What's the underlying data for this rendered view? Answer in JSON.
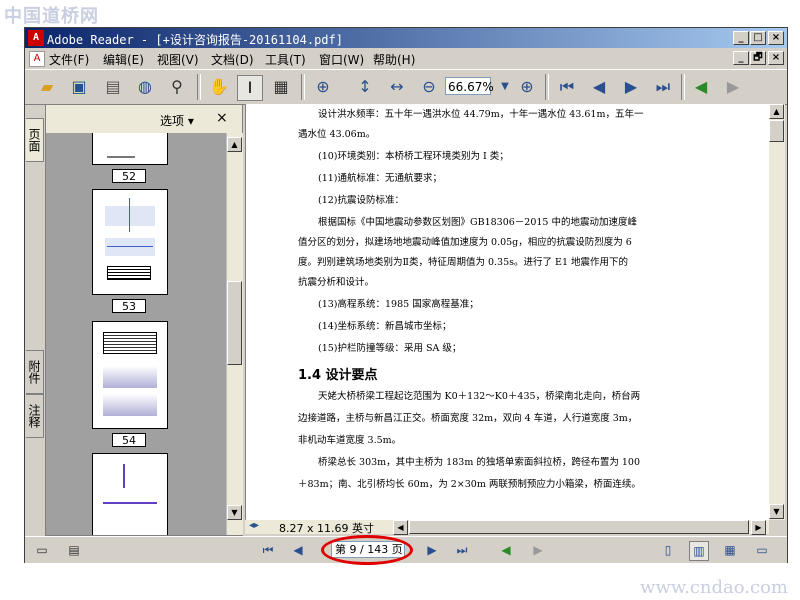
{
  "watermarks": {
    "top": "中国道桥网",
    "bottom": "www.cndao.com"
  },
  "window": {
    "title": "Adobe Reader - [+设计咨询报告-20161104.pdf]",
    "controls": [
      "_",
      "□",
      "×"
    ],
    "doc_controls": [
      "_",
      "🗗",
      "×"
    ]
  },
  "menu": [
    "文件(F)",
    "编辑(E)",
    "视图(V)",
    "文档(D)",
    "工具(T)",
    "窗口(W)",
    "帮助(H)"
  ],
  "toolbar": {
    "zoom_value": "66.67%"
  },
  "side_tabs": [
    "页面",
    "附件",
    "注释"
  ],
  "panel": {
    "options_label": "选项 ▾",
    "close_label": "×",
    "page_numbers": [
      "52",
      "53",
      "54"
    ]
  },
  "document": {
    "lines": [
      "设计洪水频率：五十年一遇洪水位 44.79m，十年一遇水位 43.61m，五年一",
      "遇水位 43.06m。",
      "(10)环境类别：本桥桥工程环境类别为 I 类；",
      "(11)通航标准：无通航要求；",
      "(12)抗震设防标准：",
      "根据国标《中国地震动参数区划图》GB18306－2015 中的地震动加速度峰",
      "值分区的划分，拟建场地地震动峰值加速度为 0.05g，相应的抗震设防烈度为 6",
      "度。判别建筑场地类别为Ⅱ类，特征周期值为 0.35s。进行了 E1 地震作用下的",
      "抗震分析和设计。",
      "(13)高程系统：1985 国家高程基准；",
      "(14)坐标系统：新昌城市坐标；",
      "(15)护栏防撞等级：采用 SA 级；",
      "1.4 设计要点",
      "天姥大桥桥梁工程起讫范围为 K0＋132～K0＋435，桥梁南北走向，桥台两",
      "边接道路，主桥与新昌江正交。桥面宽度 32m，双向 4 车道，人行道宽度 3m，",
      "非机动车道宽度 3.5m。",
      "桥梁总长 303m，其中主桥为 183m 的独塔单索面斜拉桥，跨径布置为 100",
      "＋83m；南、北引桥均长 60m，为 2×30m 两联预制预应力小箱梁，桥面连续。"
    ]
  },
  "status": {
    "page_size": "8.27 x 11.69 英寸",
    "page_indicator": "第 9 / 143 页"
  },
  "colors": {
    "title_start": "#0a246a",
    "title_end": "#a6caf0",
    "highlight_oval": "#e00000"
  }
}
